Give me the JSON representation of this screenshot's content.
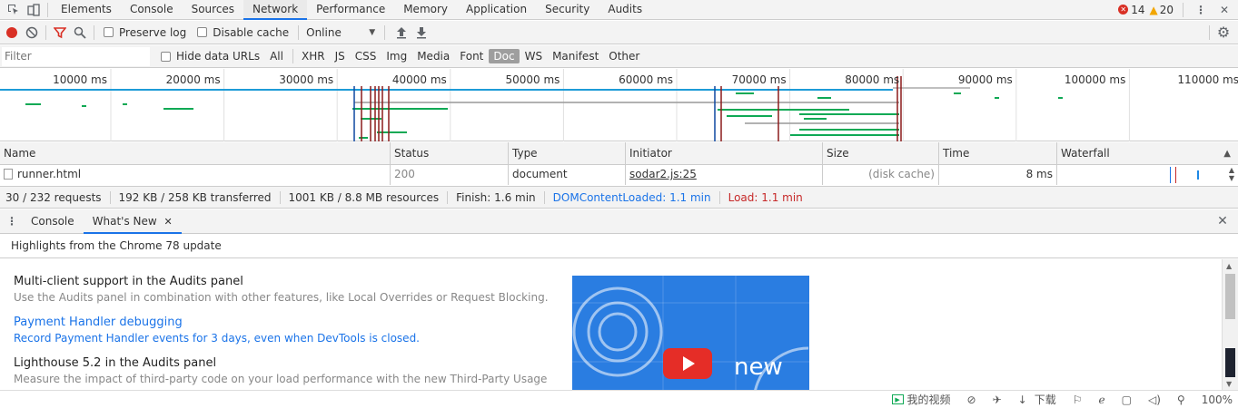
{
  "tabs": [
    "Elements",
    "Console",
    "Sources",
    "Network",
    "Performance",
    "Memory",
    "Application",
    "Security",
    "Audits"
  ],
  "active_tab": "Network",
  "errors_count": "14",
  "warnings_count": "20",
  "toolbar": {
    "preserve_log": "Preserve log",
    "disable_cache": "Disable cache",
    "throttle": "Online"
  },
  "filter": {
    "placeholder": "Filter",
    "hide_data_urls": "Hide data URLs",
    "types": [
      "All",
      "XHR",
      "JS",
      "CSS",
      "Img",
      "Media",
      "Font",
      "Doc",
      "WS",
      "Manifest",
      "Other"
    ],
    "active_type": "Doc"
  },
  "overview": {
    "ticks": [
      "10000 ms",
      "20000 ms",
      "30000 ms",
      "40000 ms",
      "50000 ms",
      "60000 ms",
      "70000 ms",
      "80000 ms",
      "90000 ms",
      "100000 ms",
      "110000 ms"
    ]
  },
  "columns": [
    "Name",
    "Status",
    "Type",
    "Initiator",
    "Size",
    "Time",
    "Waterfall"
  ],
  "rows": [
    {
      "name": "runner.html",
      "status": "200",
      "type": "document",
      "initiator": "sodar2.js:25",
      "size": "(disk cache)",
      "time": "8 ms"
    }
  ],
  "status": {
    "requests": "30 / 232 requests",
    "transferred": "192 KB / 258 KB transferred",
    "resources": "1001 KB / 8.8 MB resources",
    "finish": "Finish: 1.6 min",
    "dcl": "DOMContentLoaded: 1.1 min",
    "load": "Load: 1.1 min"
  },
  "drawer": {
    "tabs": [
      "Console",
      "What's New"
    ],
    "active": "What's New",
    "heading": "Highlights from the Chrome 78 update",
    "items": [
      {
        "title": "Multi-client support in the Audits panel",
        "desc": "Use the Audits panel in combination with other features, like Local Overrides or Request Blocking."
      },
      {
        "title": "Payment Handler debugging",
        "desc": "Record Payment Handler events for 3 days, even when DevTools is closed."
      },
      {
        "title": "Lighthouse 5.2 in the Audits panel",
        "desc": "Measure the impact of third-party code on your load performance with the new Third-Party Usage"
      }
    ],
    "video_text": "new"
  },
  "browser_status": {
    "video": "我的视频",
    "download": "下载",
    "zoom": "100%"
  },
  "colors": {
    "accent": "#1a73e8",
    "record": "#d93025",
    "dcl": "#1a73e8",
    "load": "#c62828"
  }
}
